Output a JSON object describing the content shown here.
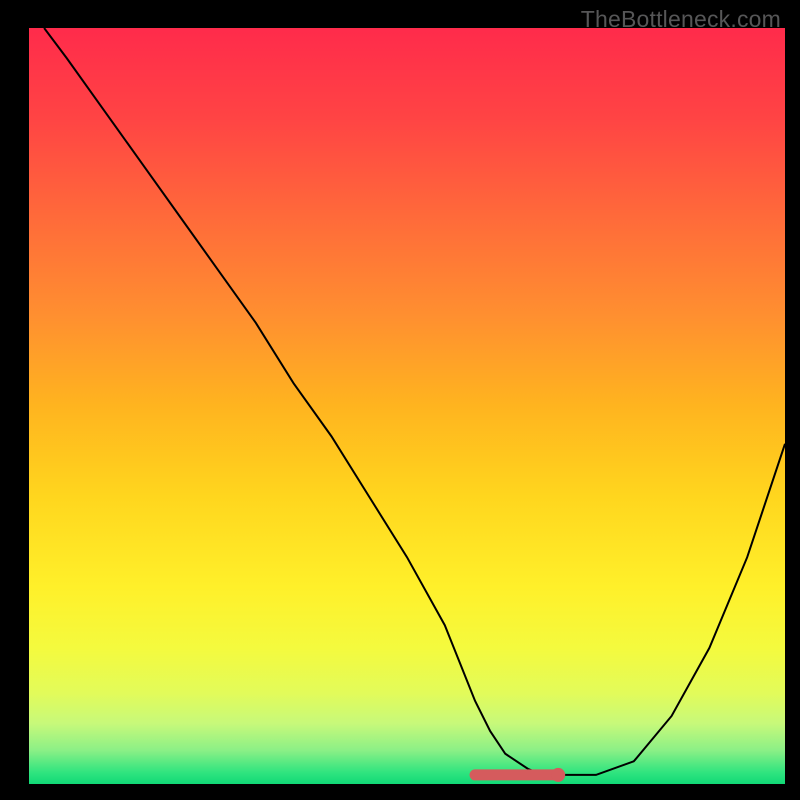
{
  "watermark": "TheBottleneck.com",
  "curve_color": "#000000",
  "flat_color": "#d55b5d",
  "background_stops": [
    {
      "offset": 0.0,
      "color": "#ff2b4b"
    },
    {
      "offset": 0.12,
      "color": "#ff4444"
    },
    {
      "offset": 0.25,
      "color": "#ff6a3a"
    },
    {
      "offset": 0.38,
      "color": "#ff8f30"
    },
    {
      "offset": 0.5,
      "color": "#ffb41f"
    },
    {
      "offset": 0.62,
      "color": "#ffd61e"
    },
    {
      "offset": 0.74,
      "color": "#fff02a"
    },
    {
      "offset": 0.82,
      "color": "#f4fa3e"
    },
    {
      "offset": 0.88,
      "color": "#e2fb5a"
    },
    {
      "offset": 0.92,
      "color": "#c7f97a"
    },
    {
      "offset": 0.955,
      "color": "#8cf086"
    },
    {
      "offset": 0.985,
      "color": "#2fe47f"
    },
    {
      "offset": 1.0,
      "color": "#11d976"
    }
  ],
  "chart_data": {
    "type": "line",
    "title": "",
    "xlabel": "",
    "ylabel": "",
    "xlim": [
      0,
      100
    ],
    "ylim": [
      0,
      100
    ],
    "curve_x": [
      2,
      5,
      10,
      15,
      20,
      25,
      30,
      35,
      40,
      45,
      50,
      55,
      57,
      59,
      61,
      63,
      66,
      68,
      70,
      75,
      80,
      85,
      90,
      95,
      100
    ],
    "curve_y": [
      100,
      96,
      89,
      82,
      75,
      68,
      61,
      53,
      46,
      38,
      30,
      21,
      16,
      11,
      7,
      4,
      2,
      1.2,
      1.2,
      1.2,
      3,
      9,
      18,
      30,
      45
    ],
    "flat_region_x": [
      59,
      70
    ],
    "flat_region_y": 1.2,
    "flat_dot_x": 70,
    "flat_dot_y": 1.2
  }
}
